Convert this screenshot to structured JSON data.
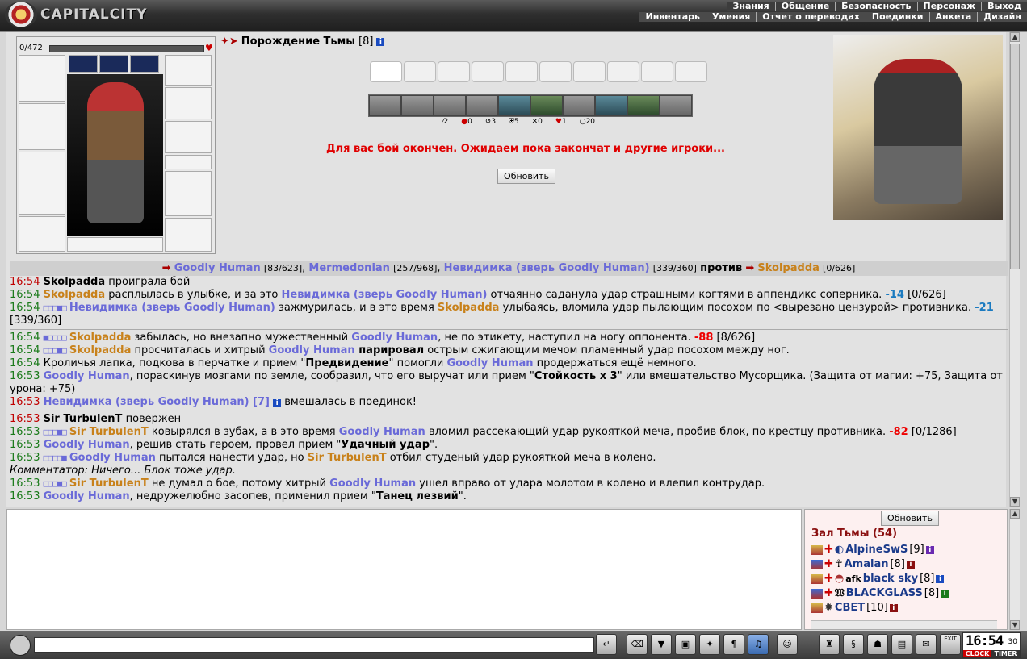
{
  "app": {
    "logo_text": "CAPITALCITY"
  },
  "menu_top": [
    "Знания",
    "Общение",
    "Безопасность",
    "Персонаж",
    "Выход"
  ],
  "menu_sub": [
    "Инвентарь",
    "Умения",
    "Отчет о переводах",
    "Поединки",
    "Анкета",
    "Дизайн"
  ],
  "player": {
    "hp": "0/472"
  },
  "opponent": {
    "name": "Порождение Тьмы",
    "level": "[8]"
  },
  "stats": [
    "2",
    "0",
    "3",
    "5",
    "0",
    "1",
    "20"
  ],
  "battle": {
    "message": "Для вас бой окончен. Ожидаем пока закончат и другие игроки...",
    "refresh_label": "Обновить"
  },
  "log": {
    "header": {
      "team1": [
        {
          "name": "Goodly Human",
          "hp": "[83/623]"
        },
        {
          "name": "Mermedonian",
          "hp": "[257/968]"
        },
        {
          "name": "Невидимка (зверь Goodly Human)",
          "hp": "[339/360]"
        }
      ],
      "vs": "против",
      "team2": [
        {
          "name": "Skolpadda",
          "hp": "[0/626]"
        }
      ]
    },
    "l1": {
      "time": "16:54",
      "who": "Skolpadda",
      "text": " проиграла бой"
    },
    "l2": {
      "time": "16:54",
      "a": "Skolpadda",
      "t1": " расплылась в улыбке, и за это ",
      "b": "Невидимка (зверь Goodly Human)",
      "t2": " отчаянно саданула удар страшными когтями в аппендикс соперника. ",
      "dmg": "-14",
      "hp": " [0/626]"
    },
    "l3": {
      "time": "16:54",
      "a": "Невидимка (зверь Goodly Human)",
      "t1": " зажмурилась, и в это время ",
      "b": "Skolpadda",
      "t2": " улыбаясь, вломила удар пылающим посохом по <вырезано цензурой> противника. ",
      "dmg": "-21",
      "hp": " [339/360]"
    },
    "l4": {
      "time": "16:54",
      "a": "Skolpadda",
      "t1": " забылась, но внезапно мужественный ",
      "b": "Goodly Human",
      "t2": ", не по этикету, наступил на ногу оппонента. ",
      "dmg": "-88",
      "hp": " [8/626]"
    },
    "l5": {
      "time": "16:54",
      "a": "Skolpadda",
      "t1": " просчиталась и хитрый ",
      "b": "Goodly Human",
      "bold": " парировал",
      "t2": " острым сжигающим мечом пламенный удар посохом между ног."
    },
    "l6": {
      "time": "16:54",
      "t1": " Кроличья лапка, подкова в перчатке и прием \"",
      "bold": "Предвидение",
      "t2": "\" помогли ",
      "b": "Goodly Human",
      "t3": " продержаться ещё немного."
    },
    "l7": {
      "time": "16:53",
      "a": "Goodly Human",
      "t1": ", пораскинув мозгами по земле, сообразил, что его выручат или прием \"",
      "bold": "Стойкость x 3",
      "t2": "\" или вмешательство Мусорщика. (Защита от магии: +75, Защита от урона: +75)"
    },
    "l8": {
      "time": "16:53",
      "a": "Невидимка (зверь Goodly Human) [7]",
      "t1": " вмешалась в поединок!"
    },
    "l9": {
      "time": "16:53",
      "who": "Sir TurbulenT",
      "text": " повержен"
    },
    "l10": {
      "time": "16:53",
      "a": "Sir TurbulenT",
      "t1": " ковырялся в зубах, а в это время ",
      "b": "Goodly Human",
      "t2": " вломил рассекающий удар рукояткой меча, пробив блок, по крестцу противника. ",
      "dmg": "-82",
      "hp": " [0/1286]"
    },
    "l11": {
      "time": "16:53",
      "a": "Goodly Human",
      "t1": ", решив стать героем, провел прием \"",
      "bold": "Удачный удар",
      "t2": "\"."
    },
    "l12": {
      "time": "16:53",
      "a": "Goodly Human",
      "t1": " пытался нанести удар, но ",
      "b": "Sir TurbulenT",
      "t2": " отбил студеный удар рукояткой меча в колено."
    },
    "l13": {
      "text": "Комментатор: Ничего... Блок тоже удар."
    },
    "l14": {
      "time": "16:53",
      "a": "Sir TurbulenT",
      "t1": " не думал о бое, потому хитрый ",
      "b": "Goodly Human",
      "t2": " ушел вправо от удара молотом в колено и влепил контрудар."
    },
    "l15": {
      "time": "16:53",
      "a": "Goodly Human",
      "t1": ", недружелюбно засопев, применил прием \"",
      "bold": "Танец лезвий",
      "t2": "\"."
    }
  },
  "room": {
    "refresh_label": "Обновить",
    "title": "Зал Тьмы (54)",
    "users": [
      {
        "prefix": "",
        "name": "AlpineSwS",
        "level": "[9]"
      },
      {
        "prefix": "",
        "name": "Amalan",
        "level": "[8]"
      },
      {
        "prefix": "afk ",
        "name": "black sky",
        "level": "[8]"
      },
      {
        "prefix": "",
        "name": "BLACKGLASS",
        "level": "[8]"
      },
      {
        "prefix": "",
        "name": "СВЕТ",
        "level": "[10]"
      }
    ]
  },
  "clock": {
    "time": "16:54",
    "seconds": "30",
    "clock_label": "CLOCK",
    "timer_label": "TIMER"
  },
  "colors": {
    "team1": "#6a6ad8",
    "team2": "#c8811a",
    "damage": "#e00000",
    "time": "#c00000"
  }
}
